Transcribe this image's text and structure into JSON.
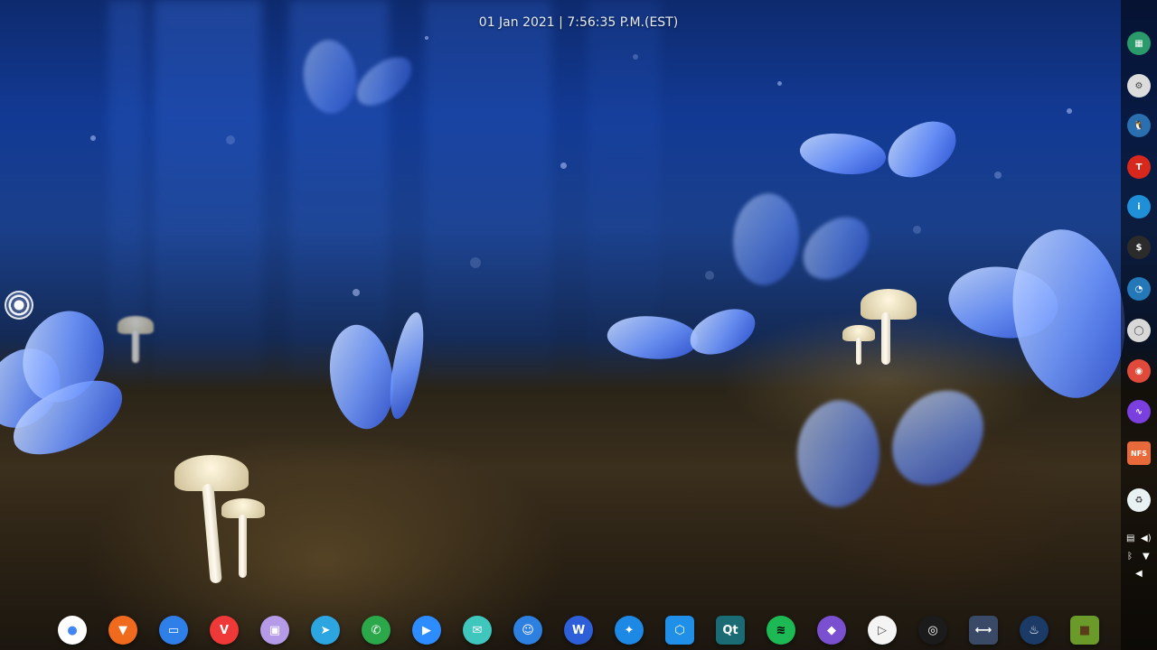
{
  "topbar": {
    "datetime": "01 Jan 2021 | 7:56:35 P.M.(EST)"
  },
  "wallpaper": {
    "description_icon": "butterflies-forest-wallpaper"
  },
  "launcher": {
    "icon": "app-launcher-icon"
  },
  "side_dock": {
    "items": [
      {
        "name": "system-monitor",
        "glyph": "▦",
        "color": "#2a9a6a"
      },
      {
        "name": "settings",
        "glyph": "⚙",
        "color": "#dcdcdc"
      },
      {
        "name": "linux-tux",
        "glyph": "🐧",
        "color": "#2a6fb0"
      },
      {
        "name": "red-app",
        "glyph": "T",
        "color": "#d8281e"
      },
      {
        "name": "info",
        "glyph": "i",
        "color": "#1f8fd8"
      },
      {
        "name": "terminal",
        "glyph": "$",
        "color": "#2b2b2b"
      },
      {
        "name": "speedometer",
        "glyph": "◔",
        "color": "#2478b8"
      },
      {
        "name": "chat",
        "glyph": "◯",
        "color": "#d8d8d8"
      },
      {
        "name": "chrome",
        "glyph": "◉",
        "color": "#e04a3a"
      },
      {
        "name": "audio-wave",
        "glyph": "∿",
        "color": "#7b3fe0"
      },
      {
        "name": "nfs-folder",
        "glyph": "NFS",
        "color": "#e86a3a"
      },
      {
        "name": "trash",
        "glyph": "♻",
        "color": "#e9f2f3"
      }
    ],
    "tray": {
      "clipboard": "▤",
      "volume": "◀)",
      "bluetooth": "ᛒ",
      "wifi": "▼",
      "collapse": "◀"
    }
  },
  "dock": {
    "items": [
      {
        "name": "google-assistant",
        "glyph": "●",
        "color": "#ffffff",
        "text": "#4285f4"
      },
      {
        "name": "brave",
        "glyph": "▼",
        "color": "#f06a1e",
        "text": "#ffffff"
      },
      {
        "name": "messages",
        "glyph": "▭",
        "color": "#2f7fe8",
        "text": "#ffffff"
      },
      {
        "name": "vivaldi",
        "glyph": "V",
        "color": "#ef3939",
        "text": "#ffffff"
      },
      {
        "name": "floppy-save",
        "glyph": "▣",
        "color": "#b59ae8",
        "text": "#ffffff"
      },
      {
        "name": "telegram",
        "glyph": "➤",
        "color": "#2ca5e0",
        "text": "#ffffff"
      },
      {
        "name": "phone",
        "glyph": "✆",
        "color": "#2aa84a",
        "text": "#ffffff"
      },
      {
        "name": "zoom",
        "glyph": "▶",
        "color": "#2d8cff",
        "text": "#ffffff"
      },
      {
        "name": "mail",
        "glyph": "✉",
        "color": "#3fc6bd",
        "text": "#ffffff"
      },
      {
        "name": "finder",
        "glyph": "☺",
        "color": "#2d7fe0",
        "text": "#ffffff"
      },
      {
        "name": "wps-writer",
        "glyph": "W",
        "color": "#2d5fd8",
        "text": "#ffffff"
      },
      {
        "name": "telescope",
        "glyph": "✦",
        "color": "#1e88e5",
        "text": "#ffffff"
      },
      {
        "name": "app-store",
        "glyph": "⬡",
        "color": "#1f8fe8",
        "text": "#ffffff"
      },
      {
        "name": "qt-app",
        "glyph": "Qt",
        "color": "#1a6b73",
        "text": "#ffffff"
      },
      {
        "name": "spotify",
        "glyph": "≋",
        "color": "#1db954",
        "text": "#000000"
      },
      {
        "name": "kdenlive",
        "glyph": "◆",
        "color": "#7a4fd0",
        "text": "#ffffff"
      },
      {
        "name": "media-player",
        "glyph": "▷",
        "color": "#f4f4f4",
        "text": "#555555"
      },
      {
        "name": "obs",
        "glyph": "◎",
        "color": "#1b1b1b",
        "text": "#ffffff"
      },
      {
        "name": "vpn-arrows",
        "glyph": "⟷",
        "color": "#3a4a66",
        "text": "#ffffff"
      },
      {
        "name": "steam",
        "glyph": "♨",
        "color": "#1b3a66",
        "text": "#ffffff"
      },
      {
        "name": "minecraft",
        "glyph": "■",
        "color": "#6a9a2a",
        "text": "#5a3b1a"
      }
    ]
  }
}
